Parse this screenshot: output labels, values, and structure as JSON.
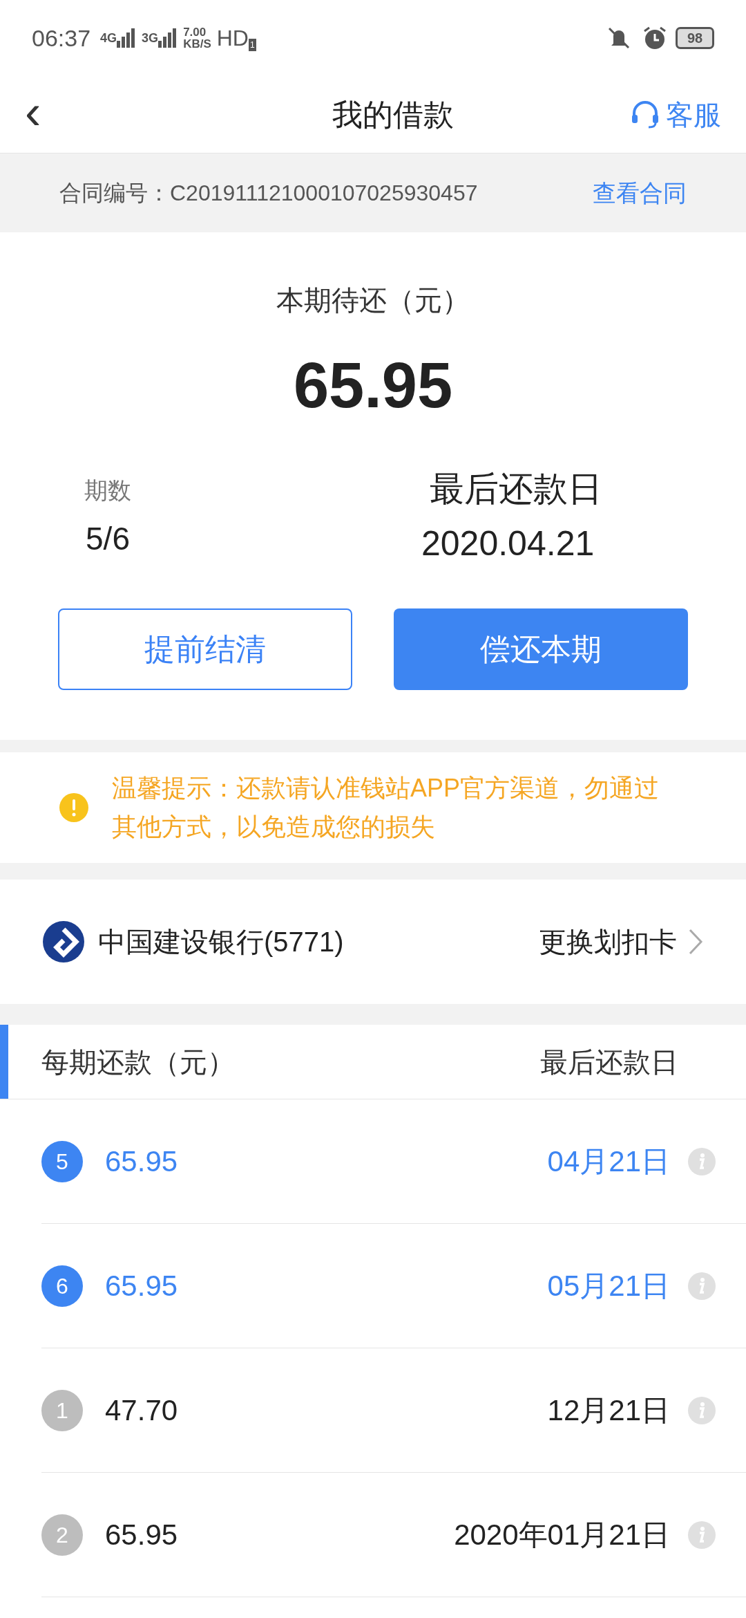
{
  "status_bar": {
    "time": "06:37",
    "net1": "4G",
    "net2": "3G",
    "speed_value": "7.00",
    "speed_unit": "KB/S",
    "hd": "HD",
    "sim": "1",
    "battery": "98"
  },
  "header": {
    "back": "‹",
    "title": "我的借款",
    "service": "客服"
  },
  "contract": {
    "label": "合同编号：C201911121000107025930457",
    "link": "查看合同"
  },
  "summary": {
    "due_label": "本期待还（元）",
    "amount": "65.95",
    "period_label": "期数",
    "period": "5/6",
    "deadline_label": "最后还款日",
    "deadline": "2020.04.21"
  },
  "buttons": [
    {
      "label": "提前结清",
      "kind": "outline"
    },
    {
      "label": "偿还本期",
      "kind": "filled"
    }
  ],
  "notice": {
    "text": "温馨提示：还款请认准钱站APP官方渠道，勿通过其他方式，以免造成您的损失"
  },
  "bank": {
    "name": "中国建设银行(5771)",
    "action": "更换划扣卡"
  },
  "schedule": {
    "col_amount": "每期还款（元）",
    "col_date": "最后还款日",
    "rows": [
      {
        "index": "5",
        "amount": "65.95",
        "date": "04月21日",
        "pending": true
      },
      {
        "index": "6",
        "amount": "65.95",
        "date": "05月21日",
        "pending": true
      },
      {
        "index": "1",
        "amount": "47.70",
        "date": "12月21日",
        "pending": false
      },
      {
        "index": "2",
        "amount": "65.95",
        "date": "2020年01月21日",
        "pending": false
      }
    ]
  }
}
